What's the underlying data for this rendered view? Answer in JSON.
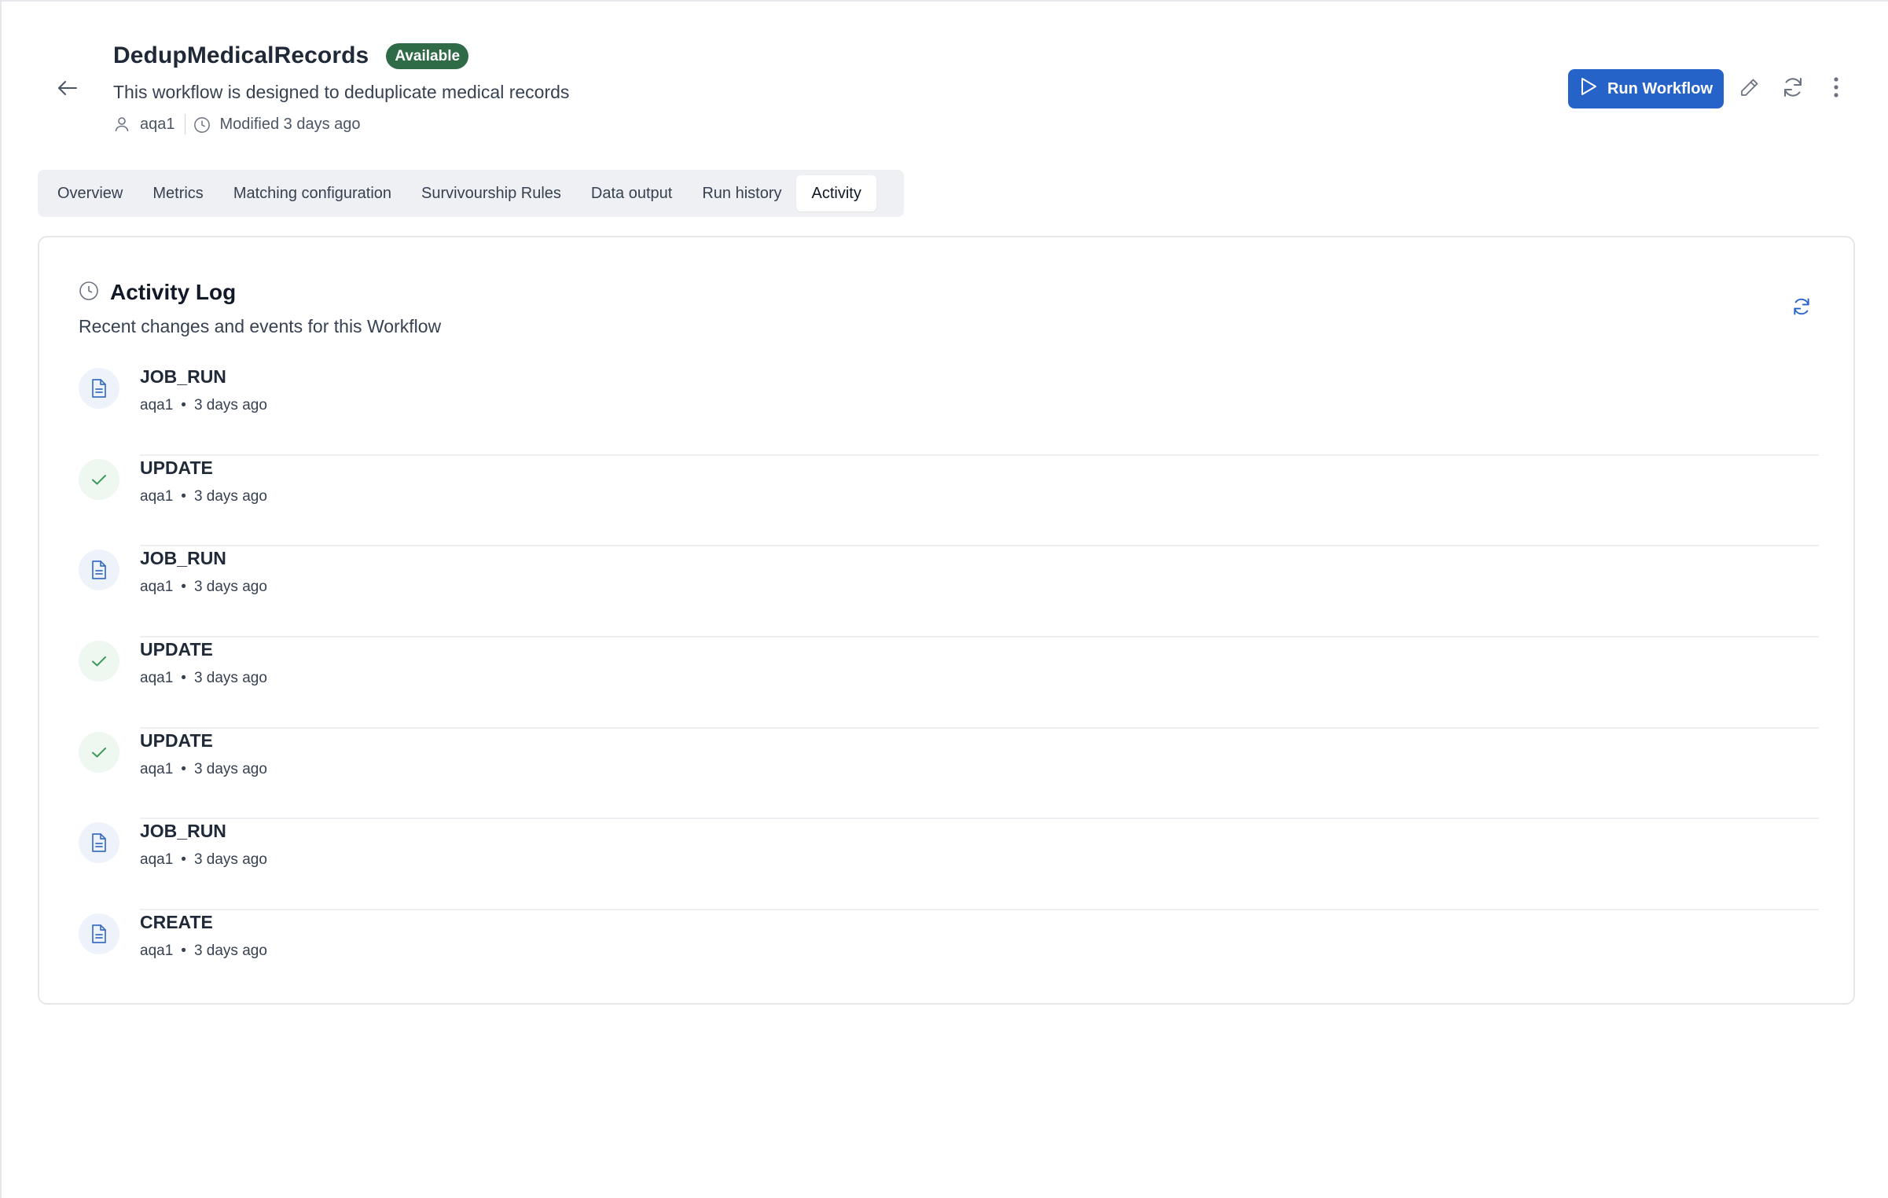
{
  "workflow": {
    "title": "DedupMedicalRecords",
    "status": "Available",
    "description": "This workflow is designed to deduplicate medical records",
    "owner": "aqa1",
    "modified": "Modified 3 days ago"
  },
  "actions": {
    "run_label": "Run Workflow",
    "accent_color": "#2563c9"
  },
  "tabs": [
    {
      "label": "Overview"
    },
    {
      "label": "Metrics"
    },
    {
      "label": "Matching configuration"
    },
    {
      "label": "Survivourship Rules"
    },
    {
      "label": "Data output"
    },
    {
      "label": "Run history"
    },
    {
      "label": "Activity",
      "active": true
    }
  ],
  "activity": {
    "title": "Activity Log",
    "subtitle": "Recent changes and events for this Workflow",
    "items": [
      {
        "type": "JOB_RUN",
        "icon": "document-icon",
        "user": "aqa1",
        "time": "3 days ago"
      },
      {
        "type": "UPDATE",
        "icon": "check-icon",
        "user": "aqa1",
        "time": "3 days ago"
      },
      {
        "type": "JOB_RUN",
        "icon": "document-icon",
        "user": "aqa1",
        "time": "3 days ago"
      },
      {
        "type": "UPDATE",
        "icon": "check-icon",
        "user": "aqa1",
        "time": "3 days ago"
      },
      {
        "type": "UPDATE",
        "icon": "check-icon",
        "user": "aqa1",
        "time": "3 days ago"
      },
      {
        "type": "JOB_RUN",
        "icon": "document-icon",
        "user": "aqa1",
        "time": "3 days ago"
      },
      {
        "type": "CREATE",
        "icon": "document-icon",
        "user": "aqa1",
        "time": "3 days ago"
      }
    ]
  },
  "colors": {
    "status_badge": "#2f6b47",
    "job_icon": "#3b6fc4",
    "ok_icon": "#3a9a5b"
  }
}
